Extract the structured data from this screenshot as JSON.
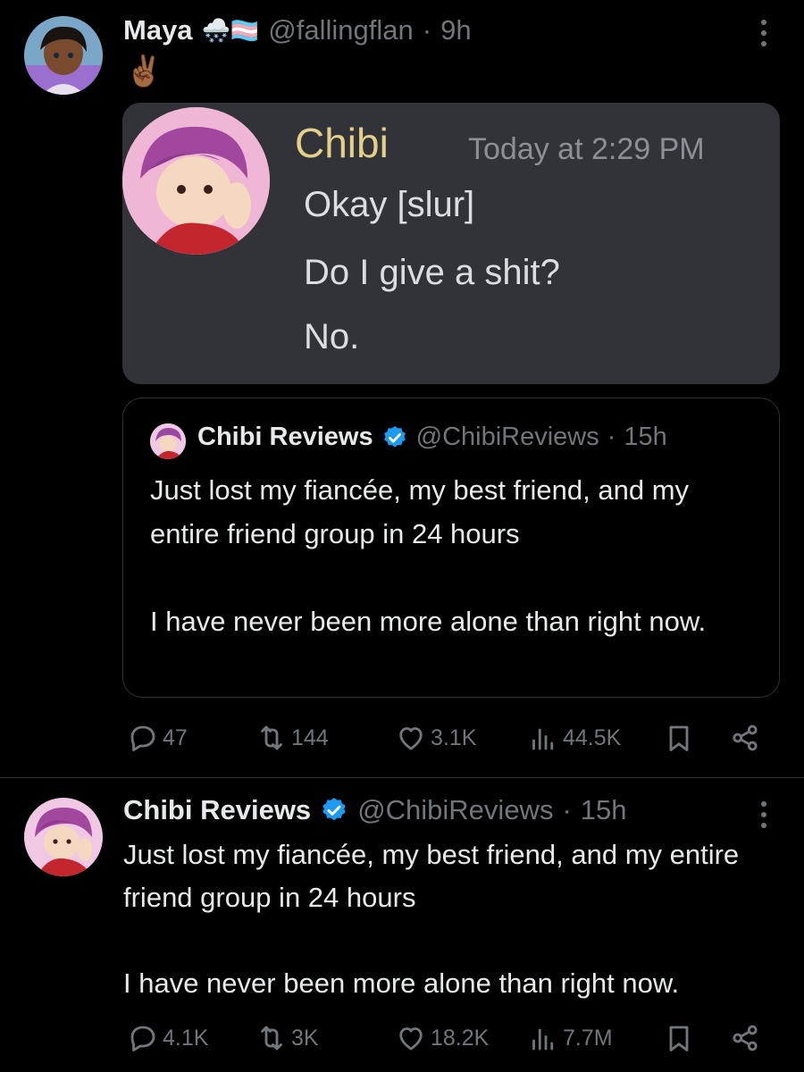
{
  "tweet1": {
    "display_name": "Maya",
    "name_emojis": "🌨️🏳️‍⚧️",
    "handle": "@fallingflan",
    "separator": "·",
    "time": "9h",
    "text": "✌🏾",
    "media": {
      "chat_name": "Chibi",
      "chat_time": "Today at 2:29 PM",
      "lines": [
        "Okay [slur]",
        "Do I give a shit?",
        "No."
      ]
    },
    "quote": {
      "display_name": "Chibi Reviews",
      "handle": "@ChibiReviews",
      "separator": "·",
      "time": "15h",
      "text_p1": "Just lost my fiancée, my best friend, and my entire friend group in 24 hours",
      "text_p2": "I have never been more alone than right now."
    },
    "stats": {
      "replies": "47",
      "reposts": "144",
      "likes": "3.1K",
      "views": "44.5K"
    }
  },
  "tweet2": {
    "display_name": "Chibi Reviews",
    "handle": "@ChibiReviews",
    "separator": "·",
    "time": "15h",
    "text_p1": "Just lost my fiancée, my best friend, and my entire friend group in 24 hours",
    "text_p2": "I have never been more alone than right now.",
    "stats": {
      "replies": "4.1K",
      "reposts": "3K",
      "likes": "18.2K",
      "views": "7.7M"
    }
  },
  "colors": {
    "background": "#000000",
    "text": "#e7e9ea",
    "secondary": "#71767b",
    "verified": "#1d9bf0",
    "media_bg": "#323339",
    "chat_name": "#e2d08a"
  },
  "icons": [
    "reply-icon",
    "repost-icon",
    "like-icon",
    "views-icon",
    "bookmark-icon",
    "share-icon",
    "verified-icon",
    "more-icon"
  ]
}
